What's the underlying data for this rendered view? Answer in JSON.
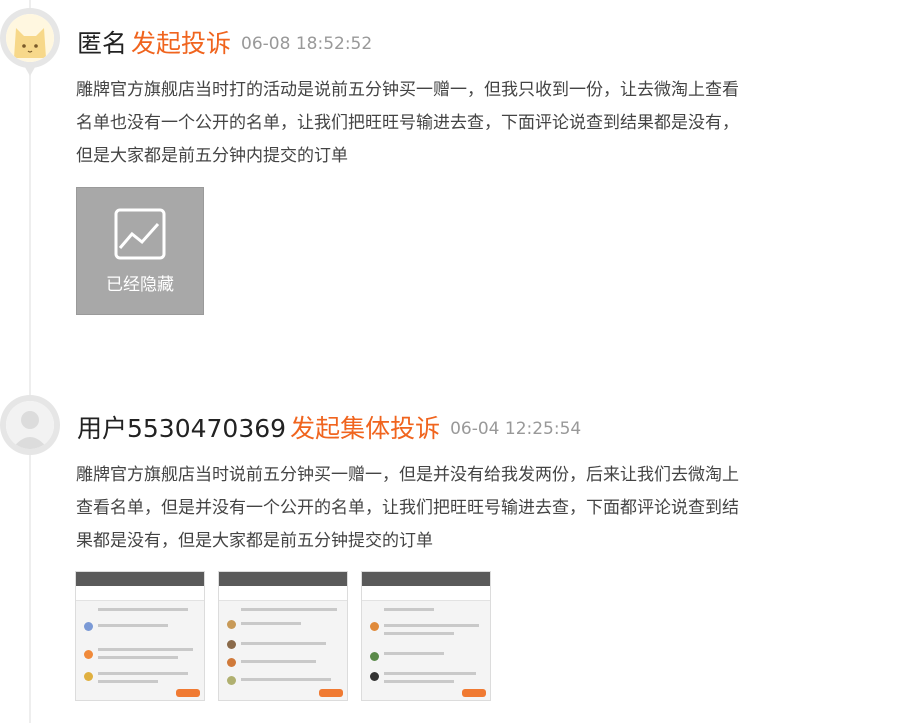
{
  "colors": {
    "action": "#f0641e",
    "timestamp": "#999999",
    "hidden_bg": "#a8a8a8"
  },
  "posts": [
    {
      "avatar_icon": "cat-face-icon",
      "username": "匿名",
      "action": "发起投诉",
      "time": "06-08 18:52:52",
      "content_lines": [
        "雕牌官方旗舰店当时打的活动是说前五分钟买一赠一，但我只收到一份，让去微淘上查看",
        "名单也没有一个公开的名单，让我们把旺旺号输进去查，下面评论说查到结果都是没有，",
        "但是大家都是前五分钟内提交的订单"
      ],
      "hidden_image_label": "已经隐藏",
      "hidden_image_icon": "image-icon"
    },
    {
      "avatar_icon": "default-user-icon",
      "username": "用户5530470369",
      "action": "发起集体投诉",
      "time": "06-04 12:25:54",
      "content_lines": [
        "雕牌官方旗舰店当时说前五分钟买一赠一，但是并没有给我发两份，后来让我们去微淘上",
        "查看名单，但是并没有一个公开的名单，让我们把旺旺号输进去查，下面都评论说查到结",
        "果都是没有，但是大家都是前五分钟提交的订单"
      ],
      "attachments": [
        "screenshot-thumbnail",
        "screenshot-thumbnail",
        "screenshot-thumbnail"
      ]
    }
  ]
}
